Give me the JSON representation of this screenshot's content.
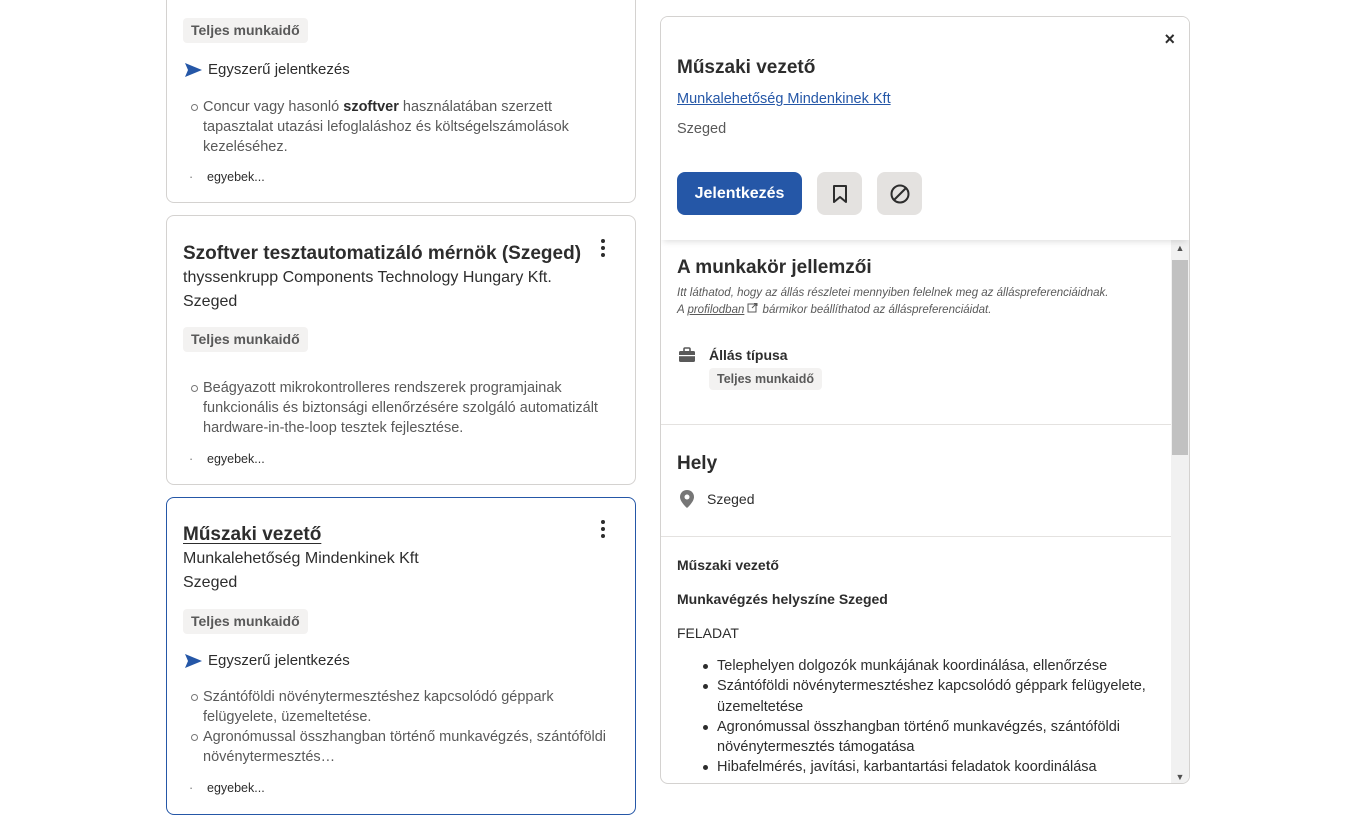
{
  "cards": [
    {
      "tag": "Teljes munkaidő",
      "easy_apply": "Egyszerű jelentkezés",
      "snippet": [
        {
          "pre": "Concur vagy hasonló ",
          "bold": "szoftver",
          "post": " használatában szerzett tapasztalat utazási lefoglaláshoz és költségelszámolások kezeléséhez."
        }
      ],
      "more": "egyebek..."
    },
    {
      "title": "Szoftver tesztautomatizáló mérnök (Szeged)",
      "company": "thyssenkrupp Components Technology Hungary Kft.",
      "location": "Szeged",
      "tag": "Teljes munkaidő",
      "snippet": [
        "Beágyazott mikrokontrolleres rendszerek programjainak funkcionális és biztonsági ellenőrzésére szolgáló automatizált hardware-in-the-loop tesztek fejlesztése."
      ],
      "more": "egyebek..."
    },
    {
      "title": "Műszaki vezető",
      "company": "Munkalehetőség Mindenkinek Kft",
      "location": "Szeged",
      "tag": "Teljes munkaidő",
      "easy_apply": "Egyszerű jelentkezés",
      "snippet": [
        "Szántóföldi növénytermesztéshez kapcsolódó géppark felügyelete, üzemeltetése.",
        "Agronómussal összhangban történő munkavégzés, szántóföldi növénytermesztés…"
      ],
      "more": "egyebek..."
    }
  ],
  "detail": {
    "close": "×",
    "title": "Műszaki vezető",
    "company": "Munkalehetőség Mindenkinek Kft",
    "location": "Szeged",
    "apply_label": "Jelentkezés",
    "job_details_title": "A munkakör jellemzői",
    "note_line1": "Itt láthatod, hogy az állás részletei mennyiben felelnek meg az álláspreferenciáidnak.",
    "note_line2_pre": "A ",
    "note_link": "profilodban",
    "note_line2_post": " bármikor beállíthatod az álláspreferenciáidat.",
    "job_type_label": "Állás típusa",
    "job_type_value": "Teljes munkaidő",
    "location_title": "Hely",
    "location_value": "Szeged",
    "desc_title": "Műszaki vezető",
    "desc_workplace": "Munkavégzés helyszíne Szeged",
    "desc_section": "FELADAT",
    "desc_items": [
      "Telephelyen dolgozók munkájának koordinálása, ellenőrzése",
      "Szántóföldi növénytermesztéshez kapcsolódó géppark felügyelete, üzemeltetése",
      "Agronómussal összhangban történő munkavégzés, szántóföldi növénytermesztés támogatása",
      "Hibafelmérés, javítási, karbantartási feladatok koordinálása"
    ]
  },
  "colors": {
    "accent": "#2557a7",
    "tag_bg": "#f3f2f1",
    "border": "#d4d2d0"
  }
}
